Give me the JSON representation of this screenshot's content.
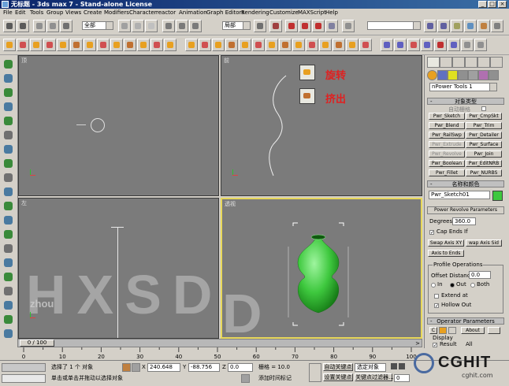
{
  "window": {
    "title": "无标题 - 3ds max 7 - Stand-alone License"
  },
  "menu": [
    "File",
    "Edit",
    "Tools",
    "Group",
    "Views",
    "Create",
    "Modifiers",
    "Character",
    "reactor",
    "Animation",
    "Graph Editors",
    "Rendering",
    "Customize",
    "MAXScript",
    "Help"
  ],
  "toolbar": {
    "selection_filter": "全部",
    "ref_coord": "局部",
    "named_sel": ""
  },
  "viewports": {
    "top": "顶",
    "front": "前",
    "left": "左",
    "perspective": "透视"
  },
  "callouts": {
    "rotate": "旋转",
    "extrude": "挤出"
  },
  "watermark": {
    "big": "HXSD",
    "small": "zhou"
  },
  "panel": {
    "plugin_dropdown": "nPower Tools 1",
    "rollout_object_type": "对象类型",
    "autogrid": "自动栅格",
    "buttons": [
      {
        "label": "Pwr_Sketch",
        "enabled": true
      },
      {
        "label": "Pwr_CmpSkt",
        "enabled": true
      },
      {
        "label": "Pwr_Blend",
        "enabled": true
      },
      {
        "label": "Pwr_Trim",
        "enabled": true
      },
      {
        "label": "Pwr_RailSwp",
        "enabled": true
      },
      {
        "label": "Pwr_Detailer",
        "enabled": true
      },
      {
        "label": "Pwr_Extrude",
        "enabled": false
      },
      {
        "label": "Pwr_Surface",
        "enabled": true
      },
      {
        "label": "Pwr_Revolve",
        "enabled": false
      },
      {
        "label": "Pwr_Join",
        "enabled": true
      },
      {
        "label": "Pwr_Boolean",
        "enabled": true
      },
      {
        "label": "Pwr_EditNRB",
        "enabled": true
      },
      {
        "label": "Pwr_Fillet",
        "enabled": true
      },
      {
        "label": "Pwr_NURBS",
        "enabled": true
      }
    ],
    "rollout_name_color": "名称和颜色",
    "object_name": "Pwr_Sketch01",
    "object_color": "#3ec83e",
    "revolve_params": "Power Revolve Parameters",
    "degrees_label": "Degrees:",
    "degrees_value": "360.0",
    "cap_ends": "Cap Ends If",
    "swap_axis_xy": "Swap Axis XY",
    "swap_axis_side": "wap Axis Sid",
    "axis_to_ends": "Axis to Ends",
    "profile_ops": "Profile Operations",
    "offset_label": "Offset Distance",
    "offset_value": "0.0",
    "radio_in": "In",
    "radio_out": "Out",
    "radio_both": "Both",
    "extend_at": "Extend at",
    "hollow_out": "Hollow Out",
    "operator_params": "Operator Parameters",
    "btn_c": "C",
    "btn_about": "About",
    "display": "Display",
    "result": "Result",
    "all": "All"
  },
  "timeline": {
    "frame": "0 / 100",
    "ticks": [
      "0",
      "10",
      "20",
      "30",
      "40",
      "50",
      "60",
      "70",
      "80",
      "90",
      "100"
    ]
  },
  "status": {
    "selected": "选择了 1 个 对象",
    "prompt": "单击或单击并拖动以选择对象",
    "x_label": "X",
    "x": "240.648",
    "y_label": "Y",
    "y": "-88.756",
    "z_label": "Z",
    "z": "0.0",
    "grid_label": "栅格 = 10.0",
    "add_time_tag": "添加时间标记",
    "auto_key": "自动关键点",
    "set_key": "设置关键点",
    "selected_obj": "选定对象",
    "key_filters": "关键点过滤器...",
    "frame_value": "0"
  },
  "logo": {
    "text": "CGHIT",
    "url": "cghit.com"
  }
}
